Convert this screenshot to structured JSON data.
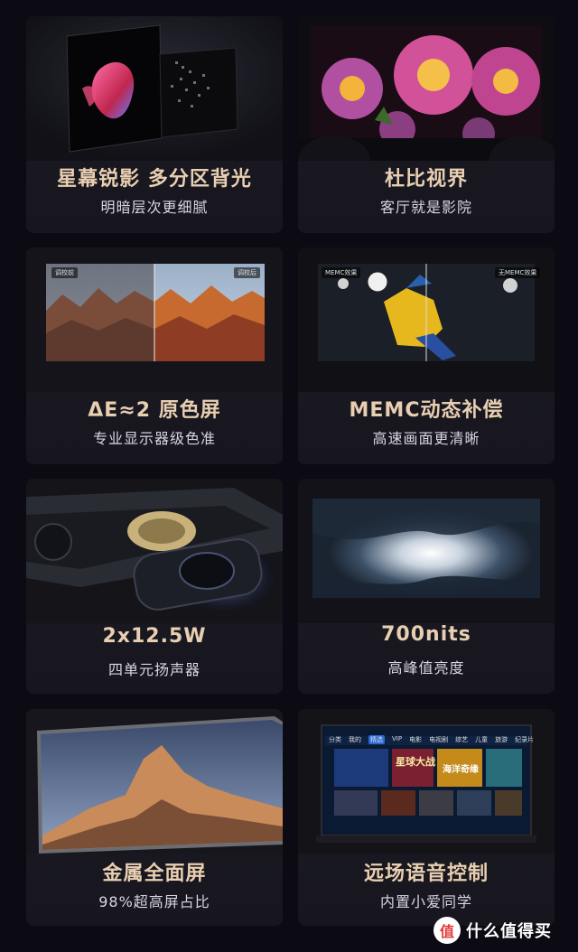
{
  "features": [
    {
      "title": "星幕锐影 多分区背光",
      "subtitle": "明暗层次更细腻"
    },
    {
      "title": "杜比视界",
      "subtitle": "客厅就是影院"
    },
    {
      "title": "ΔE≈2 原色屏",
      "subtitle": "专业显示器级色准",
      "tag_left": "调校前",
      "tag_right": "调校后"
    },
    {
      "title": "MEMC动态补偿",
      "subtitle": "高速画面更清晰",
      "tag_left": "MEMC效果",
      "tag_right": "无MEMC效果"
    },
    {
      "title": "2x12.5W",
      "subtitle": "四单元扬声器"
    },
    {
      "title": "700nits",
      "subtitle": "高峰值亮度"
    },
    {
      "title": "金属全面屏",
      "subtitle": "98%超高屏占比"
    },
    {
      "title": "远场语音控制",
      "subtitle": "内置小爱同学",
      "tv_menu": [
        "分类",
        "我的",
        "精选",
        "VIP",
        "电影",
        "电视剧",
        "综艺",
        "儿童",
        "旅游",
        "纪录片"
      ],
      "tv_posters": [
        "星球大战",
        "海洋奇缘"
      ]
    }
  ],
  "watermark": {
    "logo": "值",
    "text": "什么值得买"
  }
}
